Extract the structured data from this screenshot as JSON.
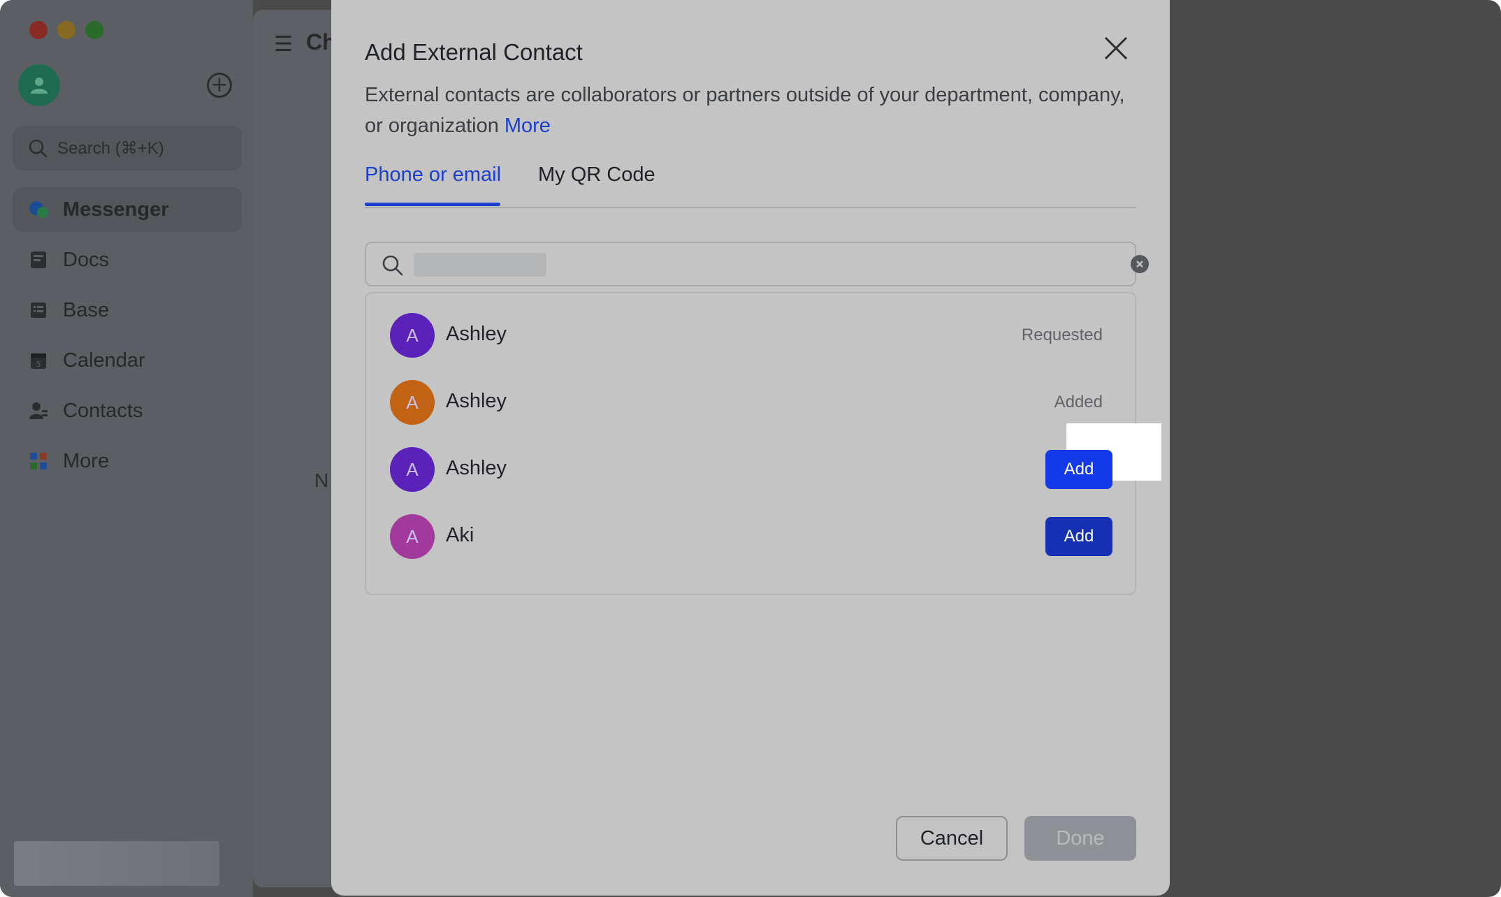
{
  "sidebar": {
    "search_placeholder": "Search (⌘+K)",
    "items": [
      {
        "label": "Messenger",
        "icon": "messenger-icon",
        "active": true
      },
      {
        "label": "Docs",
        "icon": "docs-icon"
      },
      {
        "label": "Base",
        "icon": "base-icon"
      },
      {
        "label": "Calendar",
        "icon": "calendar-icon"
      },
      {
        "label": "Contacts",
        "icon": "contacts-icon"
      },
      {
        "label": "More",
        "icon": "more-apps-icon"
      }
    ]
  },
  "main": {
    "title_fragment": "Ch",
    "body_fragment": "N"
  },
  "modal": {
    "title": "Add External Contact",
    "description": "External contacts are collaborators or partners outside of your department, company, or organization",
    "more_link": "More",
    "tabs": [
      {
        "label": "Phone or email",
        "active": true
      },
      {
        "label": "My QR Code",
        "active": false
      }
    ],
    "search": {
      "value": ""
    },
    "results": [
      {
        "initial": "A",
        "name": "Ashley",
        "status": "Requested",
        "avatar_color": "#5a22b8"
      },
      {
        "initial": "A",
        "name": "Ashley",
        "status": "Added",
        "avatar_color": "#c26214"
      },
      {
        "initial": "A",
        "name": "Ashley",
        "action": "Add",
        "avatar_color": "#5a22b8"
      },
      {
        "initial": "A",
        "name": "Aki",
        "action": "Add",
        "avatar_color": "#a23a9e"
      }
    ],
    "cancel_label": "Cancel",
    "done_label": "Done"
  },
  "colors": {
    "accent": "#1a3fcf",
    "add_button_highlighted": "#1439e6",
    "add_button": "#1630b3"
  }
}
